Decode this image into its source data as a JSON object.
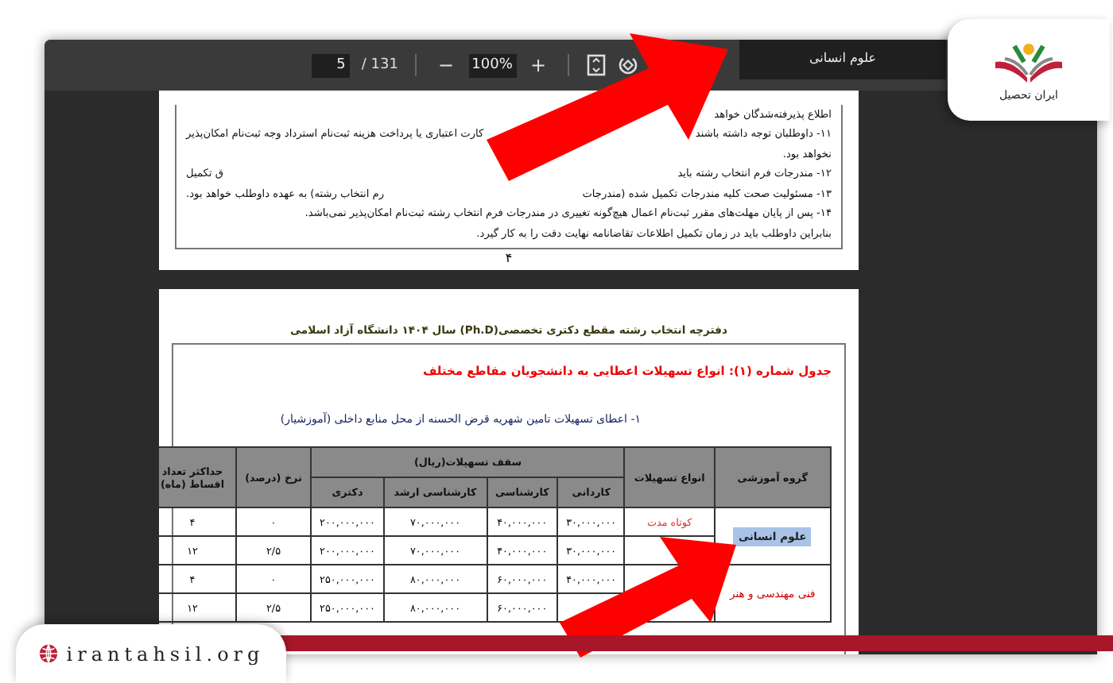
{
  "toolbar": {
    "page": "5",
    "page_total": "/ 131",
    "zoom_out": "−",
    "zoom": "100%",
    "zoom_in": "+"
  },
  "tooltip": "علوم انسانی",
  "page_one": {
    "lines": [
      {
        "parts": [
          "اطلاع پذیرفته‌شدگان خواهد"
        ]
      },
      {
        "parts": [
          "۱۱- داوطلبان توجه داشته باشند",
          "کارت اعتباری یا پرداخت هزینه ثبت‌نام استرداد وجه ثبت‌نام امکان‌پذیر"
        ]
      },
      {
        "parts": [
          "نخواهد بود."
        ]
      },
      {
        "parts": [
          "۱۲- مندرجات فرم انتخاب رشته باید",
          "ق تکمیل"
        ]
      },
      {
        "parts": [
          "۱۳- مسئولیت صحت کلیه مندرجات تکمیل شده (مندرجات",
          "رم انتخاب رشته) به عهده داوطلب خواهد بود."
        ]
      },
      {
        "parts": [
          "۱۴- پس از پایان مهلت‌های مقرر ثبت‌نام اعمال هیچ‌گونه تغییری در مندرجات فرم انتخاب رشته ثبت‌نام امکان‌پذیر نمی‌باشد."
        ]
      },
      {
        "parts": [
          "بنابراین داوطلب باید در زمان تکمیل اطلاعات تقاضانامه نهایت دقت را به کار گیرد."
        ]
      }
    ],
    "page_number": "۴"
  },
  "page_two": {
    "header": "دفترچه انتخاب رشته مقطع دکتری تخصصی(Ph.D) سال ۱۴۰۴ دانشگاه آزاد اسلامی",
    "table_title": "جدول شماره (۱): انواع تسهیلات اعطایی به دانشجویان مقاطع مختلف",
    "section_title": "۱- اعطای تسهیلات تامین شهریه قرض الحسنه از محل منابع داخلی (آموزشیار)",
    "table": {
      "group_col": "گروه آموزشی",
      "type_col": "انواع تسهیلات",
      "ceiling": "سقف تسهیلات(ریال)",
      "levels": [
        "کاردانی",
        "کارشناسی",
        "کارشناسی ارشد",
        "دکتری"
      ],
      "rate": "نرخ (درصد)",
      "installments": "حداکثر تعداد اقساط (ماه)",
      "groups": [
        {
          "name": "علوم انسانی",
          "highlighted": true,
          "rows": [
            {
              "type": "کوتاه مدت",
              "cells": [
                "۳۰,۰۰۰,۰۰۰",
                "۴۰,۰۰۰,۰۰۰",
                "۷۰,۰۰۰,۰۰۰",
                "۲۰۰,۰۰۰,۰۰۰",
                "۰",
                "۴"
              ]
            },
            {
              "type": null,
              "cells": [
                "۳۰,۰۰۰,۰۰۰",
                "۴۰,۰۰۰,۰۰۰",
                "۷۰,۰۰۰,۰۰۰",
                "۲۰۰,۰۰۰,۰۰۰",
                "۲/۵",
                "۱۲"
              ]
            }
          ]
        },
        {
          "name": "فنی مهندسی و هنر",
          "highlighted": false,
          "rows": [
            {
              "type": null,
              "cells": [
                "۴۰,۰۰۰,۰۰۰",
                "۶۰,۰۰۰,۰۰۰",
                "۸۰,۰۰۰,۰۰۰",
                "۲۵۰,۰۰۰,۰۰۰",
                "۰",
                "۴"
              ]
            },
            {
              "type": null,
              "cells": [
                null,
                "۶۰,۰۰۰,۰۰۰",
                "۸۰,۰۰۰,۰۰۰",
                "۲۵۰,۰۰۰,۰۰۰",
                "۲/۵",
                "۱۲"
              ]
            }
          ]
        }
      ]
    }
  },
  "logo": {
    "name": "ایران تحصیل"
  },
  "site_badge": {
    "url": "irantahsil.org"
  }
}
